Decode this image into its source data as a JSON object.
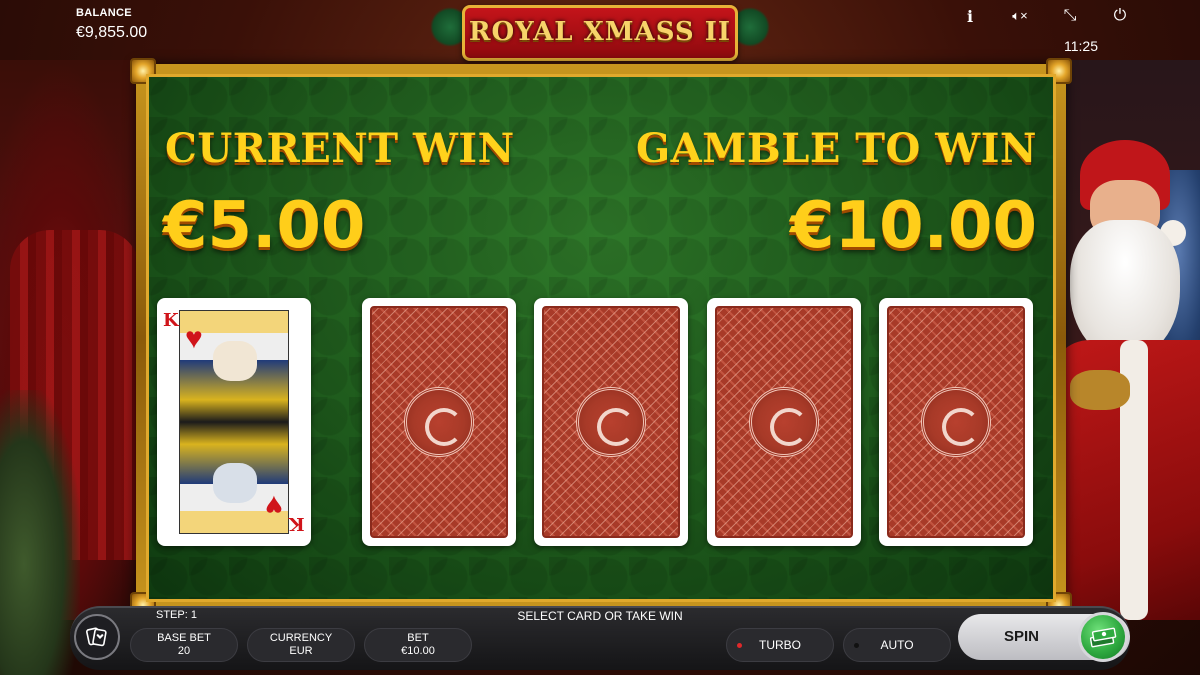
{
  "header": {
    "balance_label": "BALANCE",
    "balance_value": "€9,855.00",
    "logo_text": "ROYAL XMASS II",
    "clock": "11:25",
    "icons": [
      "info-icon",
      "sound-muted-icon",
      "fullscreen-icon",
      "power-icon"
    ],
    "info_glyph": "i",
    "sound_glyph": "🔈︎×",
    "fullscreen_glyph": "⤡",
    "power_glyph": "⏻"
  },
  "gamble": {
    "current_win_label": "CURRENT WIN",
    "current_win_value": "€5.00",
    "gamble_to_win_label": "GAMBLE TO WIN",
    "gamble_to_win_value": "€10.00",
    "dealer_card": {
      "rank": "K",
      "suit": "♥",
      "suit_name": "hearts"
    },
    "hidden_cards": 4
  },
  "bottom_bar": {
    "step_label": "STEP: 1",
    "status_text": "SELECT CARD OR TAKE WIN",
    "base_bet_label": "BASE BET",
    "base_bet_value": "20",
    "currency_label": "CURRENCY",
    "currency_value": "EUR",
    "bet_label": "BET",
    "bet_value": "€10.00",
    "turbo_label": "TURBO",
    "auto_label": "AUTO",
    "spin_label": "SPIN"
  },
  "colors": {
    "gold_text": "#ffd21c",
    "felt_green": "#1e5a1c",
    "card_back_red": "#a83a28",
    "turbo_dot": "#e0282a",
    "auto_dot": "#2a2a2e",
    "collect_green": "#2faa40"
  }
}
